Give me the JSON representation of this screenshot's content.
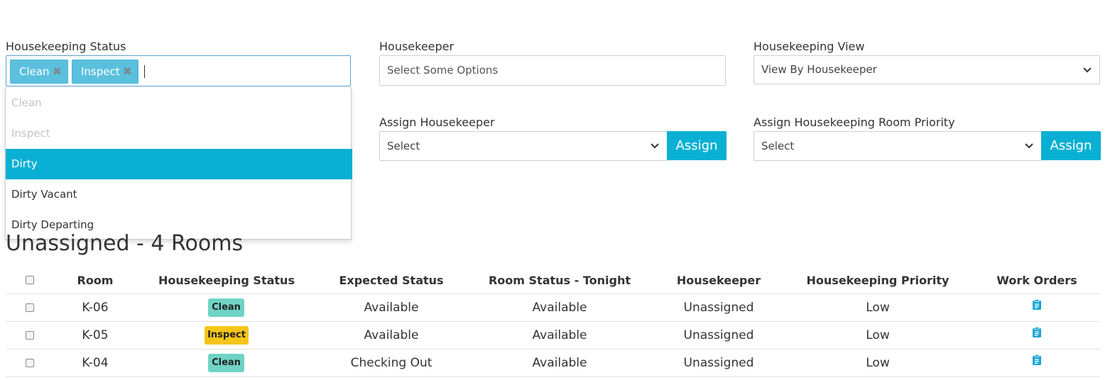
{
  "filters": {
    "housekeeping_status": {
      "label": "Housekeeping Status",
      "selected_chips": [
        "Clean",
        "Inspect"
      ],
      "options": [
        {
          "label": "Clean",
          "state": "disabled"
        },
        {
          "label": "Inspect",
          "state": "disabled"
        },
        {
          "label": "Dirty",
          "state": "highlighted"
        },
        {
          "label": "Dirty Vacant",
          "state": "normal"
        },
        {
          "label": "Dirty Departing",
          "state": "normal"
        }
      ]
    },
    "housekeeper": {
      "label": "Housekeeper",
      "placeholder": "Select Some Options"
    },
    "housekeeping_view": {
      "label": "Housekeeping View",
      "value": "View By Housekeeper"
    },
    "assign_housekeeper": {
      "label": "Assign Housekeeper",
      "value": "Select",
      "button": "Assign"
    },
    "assign_priority": {
      "label": "Assign Housekeeping Room Priority",
      "value": "Select",
      "button": "Assign"
    }
  },
  "section": {
    "title": "Unassigned - 4 Rooms"
  },
  "table": {
    "headers": [
      "Room",
      "Housekeeping Status",
      "Expected Status",
      "Room Status - Tonight",
      "Housekeeper",
      "Housekeeping Priority",
      "Work Orders"
    ],
    "rows": [
      {
        "room": "K-06",
        "status": "Clean",
        "expected": "Available",
        "tonight": "Available",
        "housekeeper": "Unassigned",
        "priority": "Low",
        "work_order_icon": "clipboard-icon"
      },
      {
        "room": "K-05",
        "status": "Inspect",
        "expected": "Available",
        "tonight": "Available",
        "housekeeper": "Unassigned",
        "priority": "Low",
        "work_order_icon": "clipboard-icon"
      },
      {
        "room": "K-04",
        "status": "Clean",
        "expected": "Checking Out",
        "tonight": "Available",
        "housekeeper": "Unassigned",
        "priority": "Low",
        "work_order_icon": "clipboard-icon"
      }
    ]
  },
  "colors": {
    "accent": "#0ab0d3",
    "chip": "#5bc0de",
    "status_clean": "#6fd3c6",
    "status_inspect": "#f5c518"
  }
}
